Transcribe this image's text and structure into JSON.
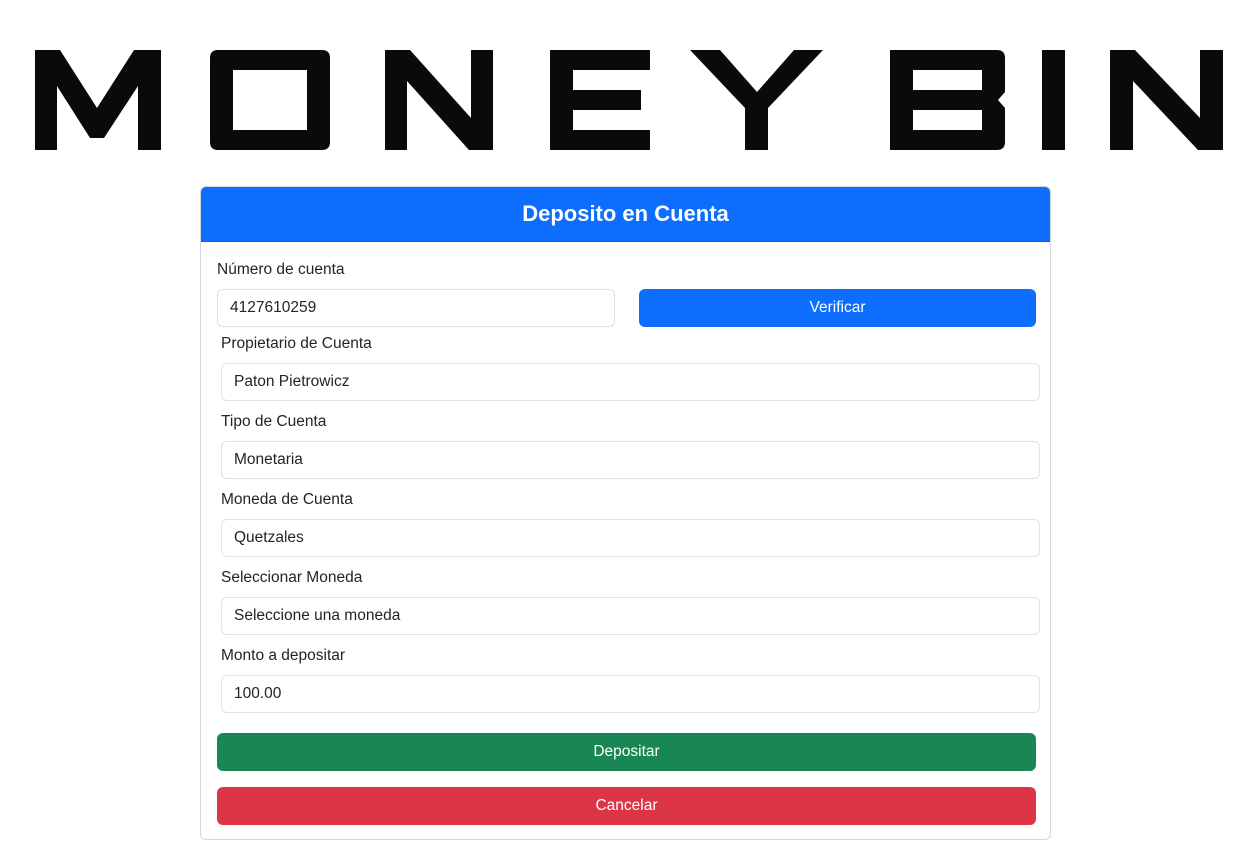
{
  "logo": {
    "text": "MONEY BIN"
  },
  "form": {
    "title": "Deposito en Cuenta",
    "account_number": {
      "label": "Número de cuenta",
      "value": "4127610259"
    },
    "verify_button": "Verificar",
    "owner": {
      "label": "Propietario de Cuenta",
      "value": "Paton Pietrowicz"
    },
    "account_type": {
      "label": "Tipo de Cuenta",
      "value": "Monetaria"
    },
    "account_currency": {
      "label": "Moneda de Cuenta",
      "value": "Quetzales"
    },
    "select_currency": {
      "label": "Seleccionar Moneda",
      "value": "Seleccione una moneda"
    },
    "amount": {
      "label": "Monto a depositar",
      "value": "100.00"
    },
    "deposit_button": "Depositar",
    "cancel_button": "Cancelar"
  },
  "colors": {
    "primary": "#0d6efd",
    "success": "#198754",
    "danger": "#dc3545"
  }
}
